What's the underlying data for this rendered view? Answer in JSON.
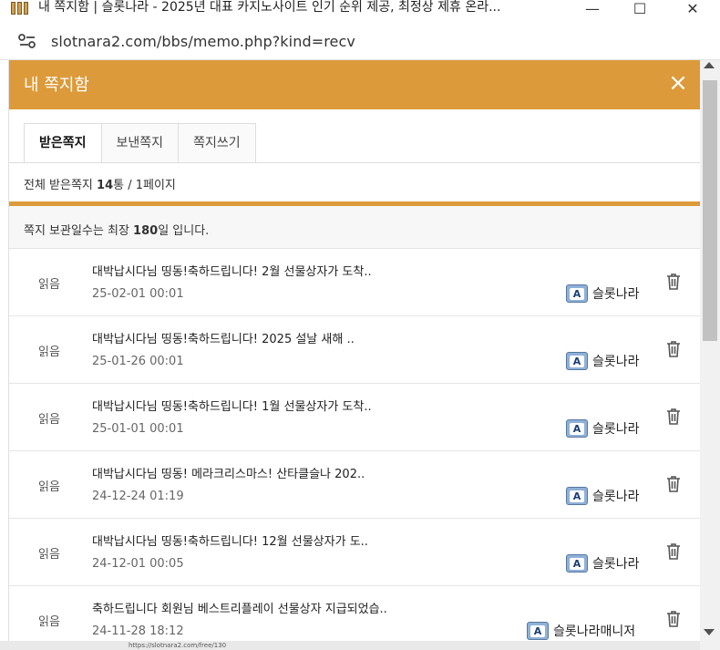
{
  "window": {
    "title": "내 쪽지함 | 슬롯나라 - 2025년 대표 카지노사이트 인기 순위 제공, 최정상 제휴 온라...",
    "minimize_glyph": "—",
    "maximize_glyph": "☐",
    "close_glyph": "✕"
  },
  "address": {
    "url": "slotnara2.com/bbs/memo.php?kind=recv"
  },
  "header": {
    "title": "내 쪽지함",
    "close_glyph": "×",
    "color": "#dc9a3a"
  },
  "tabs": [
    {
      "label": "받은쪽지",
      "active": true
    },
    {
      "label": "보낸쪽지",
      "active": false
    },
    {
      "label": "쪽지쓰기",
      "active": false
    }
  ],
  "summary": {
    "prefix": "전체 받은쪽지 ",
    "count": "14",
    "suffix": "통 / 1페이지"
  },
  "notice": {
    "prefix": "쪽지 보관일수는 최장 ",
    "days": "180",
    "suffix": "일 입니다."
  },
  "level_icon_letter": "A",
  "messages": [
    {
      "status": "읽음",
      "subject": "대박납시다님 띵동!축하드립니다! 2월 선물상자가 도착..",
      "date": "25-02-01 00:01",
      "sender": "슬롯나라"
    },
    {
      "status": "읽음",
      "subject": "대박납시다님 띵동!축하드립니다! 2025 설날 새해 ..",
      "date": "25-01-26 00:01",
      "sender": "슬롯나라"
    },
    {
      "status": "읽음",
      "subject": "대박납시다님 띵동!축하드립니다! 1월 선물상자가 도착..",
      "date": "25-01-01 00:01",
      "sender": "슬롯나라"
    },
    {
      "status": "읽음",
      "subject": "대박납시다님 띵동! 메라크리스마스! 산타클슬나 202..",
      "date": "24-12-24 01:19",
      "sender": "슬롯나라"
    },
    {
      "status": "읽음",
      "subject": "대박납시다님 띵동!축하드립니다! 12월 선물상자가 도..",
      "date": "24-12-01 00:05",
      "sender": "슬롯나라"
    },
    {
      "status": "읽음",
      "subject": "축하드립니다 회원님 베스트리플레이 선물상자 지급되었습..",
      "date": "24-11-28 18:12",
      "sender": "슬롯나라매니저"
    }
  ],
  "bottom_link": "https://slotnara2.com/free/130"
}
